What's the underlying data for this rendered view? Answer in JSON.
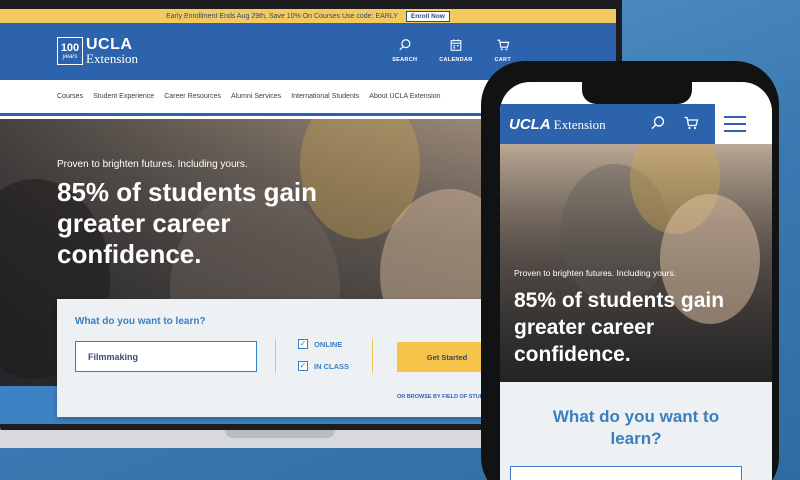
{
  "promo": {
    "text": "Early Enrollment Ends Aug 29th, Save 10% On Courses Use code: EARLY",
    "button": "Enroll Now"
  },
  "brand": {
    "badge_number": "100",
    "badge_word": "years",
    "name": "UCLA",
    "sub": "Extension",
    "colors": {
      "primary": "#2d63ad",
      "accent": "#f5c24a",
      "link": "#3a7fc1"
    }
  },
  "header_actions": [
    {
      "label": "SEARCH",
      "icon": "search-icon"
    },
    {
      "label": "CALENDAR",
      "icon": "calendar-icon"
    },
    {
      "label": "CART",
      "icon": "cart-icon"
    }
  ],
  "nav": [
    "Courses",
    "Student Experience",
    "Career Resources",
    "Alumni Services",
    "International Students",
    "About UCLA Extension"
  ],
  "hero": {
    "eyebrow": "Proven to brighten futures. Including yours.",
    "headline": "85% of students gain greater career confidence."
  },
  "search": {
    "title": "What do you want to learn?",
    "input_value": "Filmmaking",
    "options": [
      {
        "label": "ONLINE",
        "checked": true
      },
      {
        "label": "IN CLASS",
        "checked": true
      }
    ],
    "button": "Get Started",
    "browse": "OR BROWSE BY FIELD OF STUD"
  },
  "mobile": {
    "logo_name": "UCLA",
    "logo_sub": "Extension",
    "eyebrow": "Proven to brighten futures. Including yours.",
    "headline": "85% of students gain greater career confidence.",
    "search_title": "What do you want to learn?"
  }
}
